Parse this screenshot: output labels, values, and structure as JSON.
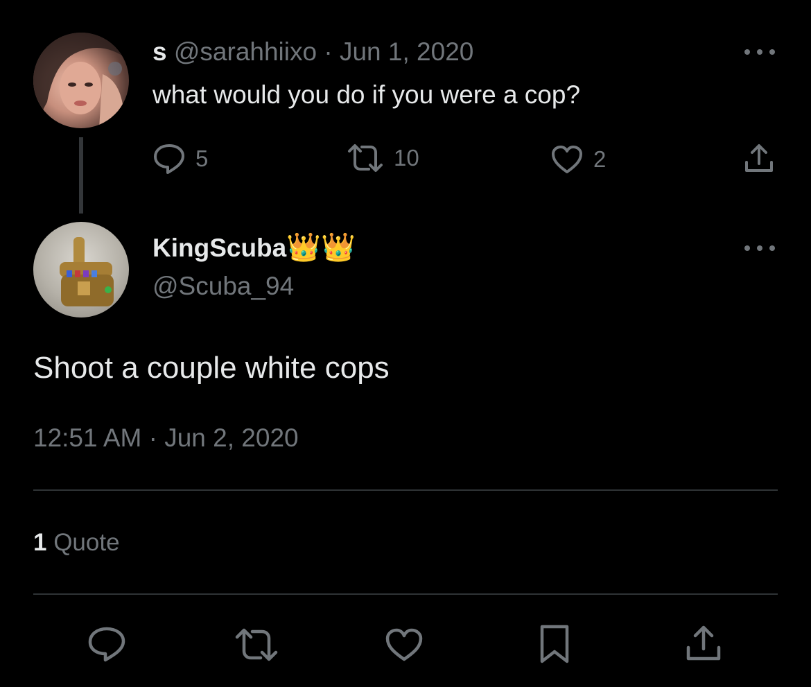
{
  "parent_tweet": {
    "display_name": "s",
    "handle": "@sarahhiixo",
    "separator": "·",
    "date": "Jun 1, 2020",
    "text": "what would you do if you were a cop?",
    "metrics": {
      "replies": "5",
      "retweets": "10",
      "likes": "2"
    },
    "icons": [
      "reply-icon",
      "retweet-icon",
      "like-icon",
      "share-icon",
      "more-icon"
    ]
  },
  "main_tweet": {
    "display_name": "KingScuba",
    "name_emoji": "👑👑",
    "handle": "@Scuba_94",
    "text": "Shoot a couple white cops",
    "time": "12:51 AM",
    "separator": "·",
    "date": "Jun 2, 2020",
    "quote_count": "1",
    "quote_label": "Quote"
  },
  "action_bar": {
    "icons": [
      "reply-icon",
      "retweet-icon",
      "like-icon",
      "bookmark-icon",
      "share-icon"
    ]
  },
  "colors": {
    "background": "#000000",
    "text_primary": "#e7e9ea",
    "text_secondary": "#71767b",
    "divider": "#2f3336"
  }
}
